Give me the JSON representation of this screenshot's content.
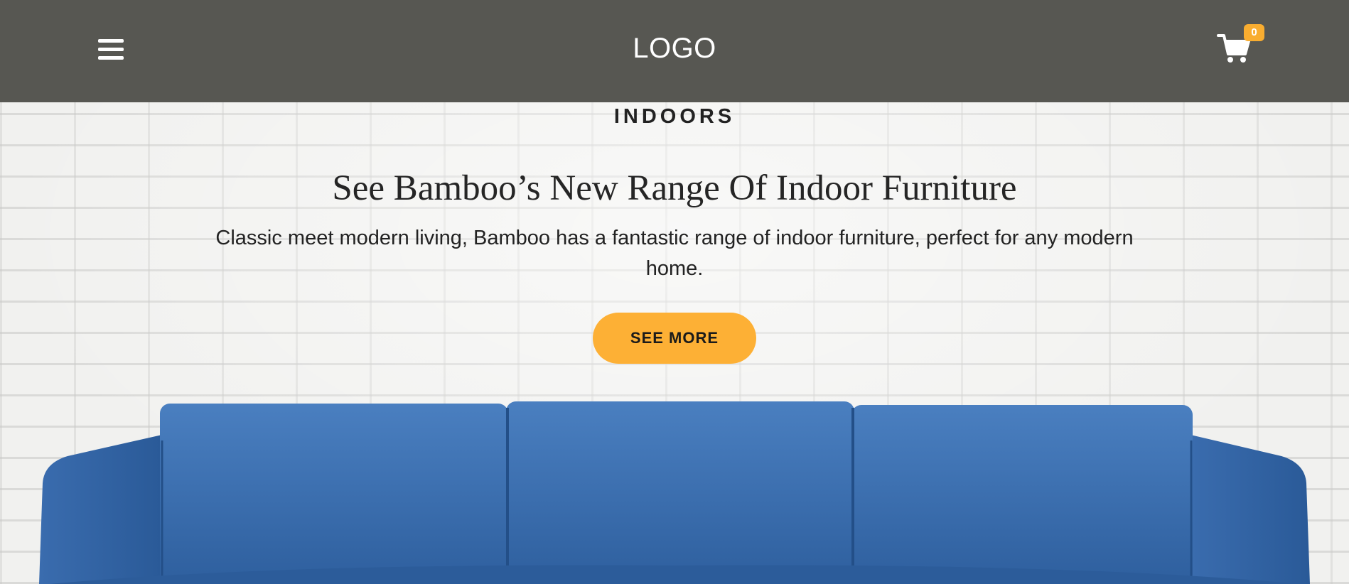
{
  "header": {
    "logo_text": "LOGO",
    "menu_icon": "hamburger-menu-icon",
    "cart_icon": "shopping-cart-icon",
    "cart_count": "0",
    "background_color": "#575752"
  },
  "hero": {
    "eyebrow": "INDOORS",
    "title": "See Bamboo’s New Range Of Indoor Furniture",
    "description": "Classic meet modern living, Bamboo has a fantastic range of indoor furniture, perfect for any modern home.",
    "cta_label": "SEE MORE",
    "accent_color": "#fdb035"
  }
}
